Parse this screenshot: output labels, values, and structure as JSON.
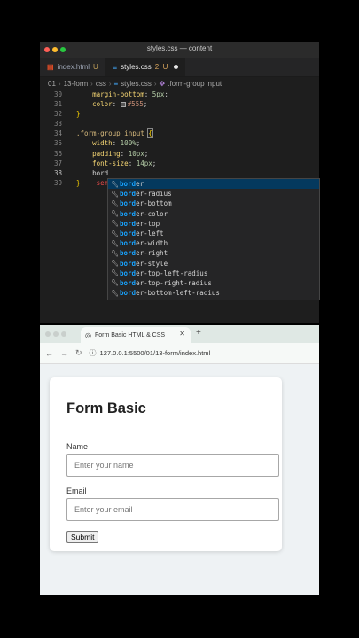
{
  "editor": {
    "window_title": "styles.css — content",
    "tabs": [
      {
        "label": "index.html",
        "badge": "U"
      },
      {
        "label": "styles.css",
        "badge": "2, U"
      }
    ],
    "breadcrumb": [
      "01",
      "13-form",
      "css",
      "styles.css",
      ".form-group input"
    ],
    "code": {
      "line30": {
        "num": "30",
        "prop": "margin-bottom",
        "val": "5px",
        "end": ";"
      },
      "line31": {
        "num": "31",
        "prop": "color",
        "val": "#555",
        "end": ";"
      },
      "line32": {
        "num": "32",
        "text": "}"
      },
      "line33": {
        "num": "33"
      },
      "line34": {
        "num": "34",
        "selector": ".form-group input",
        "brace": "{"
      },
      "line35": {
        "num": "35",
        "prop": "width",
        "val": "100%",
        "end": ";"
      },
      "line36": {
        "num": "36",
        "prop": "padding",
        "val": "10px",
        "end": ";"
      },
      "line37": {
        "num": "37",
        "prop": "font-size",
        "val": "14px",
        "end": ";"
      },
      "line38": {
        "num": "38",
        "text": "bord"
      },
      "line39": {
        "num": "39",
        "brace": "}",
        "text": "sem"
      }
    },
    "suggestions": [
      {
        "match": "bord",
        "rest": "er"
      },
      {
        "match": "bord",
        "rest": "er-radius"
      },
      {
        "match": "bord",
        "rest": "er-bottom"
      },
      {
        "match": "bord",
        "rest": "er-color"
      },
      {
        "match": "bord",
        "rest": "er-top"
      },
      {
        "match": "bord",
        "rest": "er-left"
      },
      {
        "match": "bord",
        "rest": "er-width"
      },
      {
        "match": "bord",
        "rest": "er-right"
      },
      {
        "match": "bord",
        "rest": "er-style"
      },
      {
        "match": "bord",
        "rest": "er-top-left-radius"
      },
      {
        "match": "bord",
        "rest": "er-top-right-radius"
      },
      {
        "match": "bord",
        "rest": "er-bottom-left-radius"
      }
    ]
  },
  "browser": {
    "tab_title": "Form Basic HTML & CSS",
    "url": "127.0.0.1:5500/01/13-form/index.html",
    "form": {
      "title": "Form Basic",
      "name_label": "Name",
      "name_placeholder": "Enter your name",
      "email_label": "Email",
      "email_placeholder": "Enter your email",
      "submit_label": "Submit"
    }
  },
  "colors": {
    "swatch": "#555",
    "accent": "#18a3ff"
  }
}
